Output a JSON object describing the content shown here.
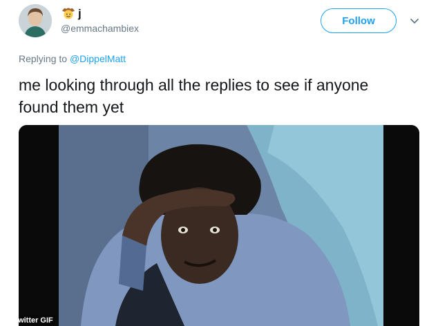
{
  "user": {
    "display_name": "j",
    "name_emoji": "cowboy-face-icon",
    "handle": "@emmachambiex",
    "avatar": "avatar-photo"
  },
  "follow_button": {
    "label": "Follow"
  },
  "reply": {
    "prefix": "Replying to",
    "mention": "@DippelMatt"
  },
  "tweet": {
    "text": "me looking through all the replies to see if anyone found them yet"
  },
  "media": {
    "type": "GIF",
    "watermark": "© Twitter",
    "badge_label": "GIF"
  },
  "colors": {
    "accent": "#1da1f2",
    "secondary_text": "#657786",
    "primary_text": "#14171a"
  }
}
